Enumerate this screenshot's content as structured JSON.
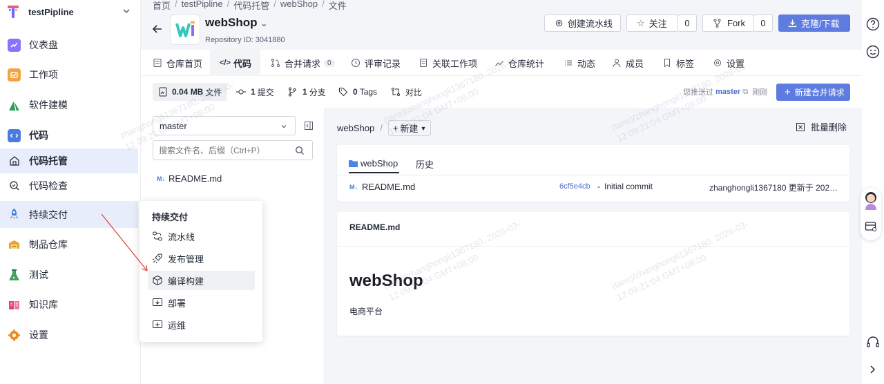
{
  "sidebar": {
    "project": "testPipline",
    "items": [
      {
        "label": "仪表盘",
        "icon": "dashboard-icon",
        "color": "#7b61ff"
      },
      {
        "label": "工作项",
        "icon": "workitem-icon",
        "color": "#f0a040"
      },
      {
        "label": "软件建模",
        "icon": "modeling-icon",
        "color": "#3fa35b"
      },
      {
        "label": "代码",
        "icon": "code-icon",
        "color": "#4a7be0"
      },
      {
        "label": "代码托管",
        "icon": "repo-icon"
      },
      {
        "label": "代码检查",
        "icon": "codecheck-icon"
      },
      {
        "label": "持续交付",
        "icon": "delivery-icon",
        "color": "#3b7be0"
      },
      {
        "label": "制品仓库",
        "icon": "artifact-icon",
        "color": "#e0a030"
      },
      {
        "label": "测试",
        "icon": "test-icon",
        "color": "#3fa35b"
      },
      {
        "label": "知识库",
        "icon": "wiki-icon",
        "color": "#e0407a"
      },
      {
        "label": "设置",
        "icon": "settings-icon",
        "color": "#f08a20"
      }
    ]
  },
  "popover": {
    "title": "持续交付",
    "items": [
      "流水线",
      "发布管理",
      "编译构建",
      "部署",
      "运维"
    ]
  },
  "breadcrumb": [
    "首页",
    "testPipline",
    "代码托管",
    "webShop",
    "文件"
  ],
  "repo": {
    "name": "webShop",
    "id_label": "Repository ID:",
    "id": "3041880"
  },
  "actions": {
    "create_pipeline": "创建流水线",
    "watch": "关注",
    "watch_count": "0",
    "fork": "Fork",
    "fork_count": "0",
    "clone": "克隆/下载"
  },
  "tabs": [
    {
      "label": "仓库首页"
    },
    {
      "label": "代码"
    },
    {
      "label": "合并请求",
      "badge": "0"
    },
    {
      "label": "评审记录"
    },
    {
      "label": "关联工作项"
    },
    {
      "label": "仓库统计"
    },
    {
      "label": "动态"
    },
    {
      "label": "成员"
    },
    {
      "label": "标签"
    },
    {
      "label": "设置"
    }
  ],
  "stats": {
    "size": "0.04 MB",
    "size_label": "文件",
    "commits": "1",
    "commits_label": "提交",
    "branches": "1",
    "branches_label": "分支",
    "tags": "0",
    "tags_label": "Tags",
    "compare": "对比",
    "push_prefix": "您推送过",
    "push_branch": "master",
    "push_time": "刚刚",
    "new_mr": "新建合并请求"
  },
  "files": {
    "branch": "master",
    "search_placeholder": "搜索文件名、后缀（Ctrl+P）",
    "tree": [
      "README.md"
    ]
  },
  "content": {
    "path": "webShop",
    "new_label": "新建",
    "bulk_delete": "批量删除",
    "tab_folder": "webShop",
    "tab_history": "历史",
    "file_name": "README.md",
    "commit_hash": "6cf5e4cb",
    "commit_dash": "-",
    "commit_msg": "Initial commit",
    "commit_meta": "zhanghongli1367180 更新于 202…"
  },
  "readme": {
    "title": "README.md",
    "heading": "webShop",
    "body": "电商平台"
  },
  "watermark": {
    "line1": "zhanghongli1367180, 2026-03-",
    "line2": "(tans)/zhanghongli1367180, 2026-03-",
    "line3": "12 09:21:04 GMT+08:00"
  }
}
